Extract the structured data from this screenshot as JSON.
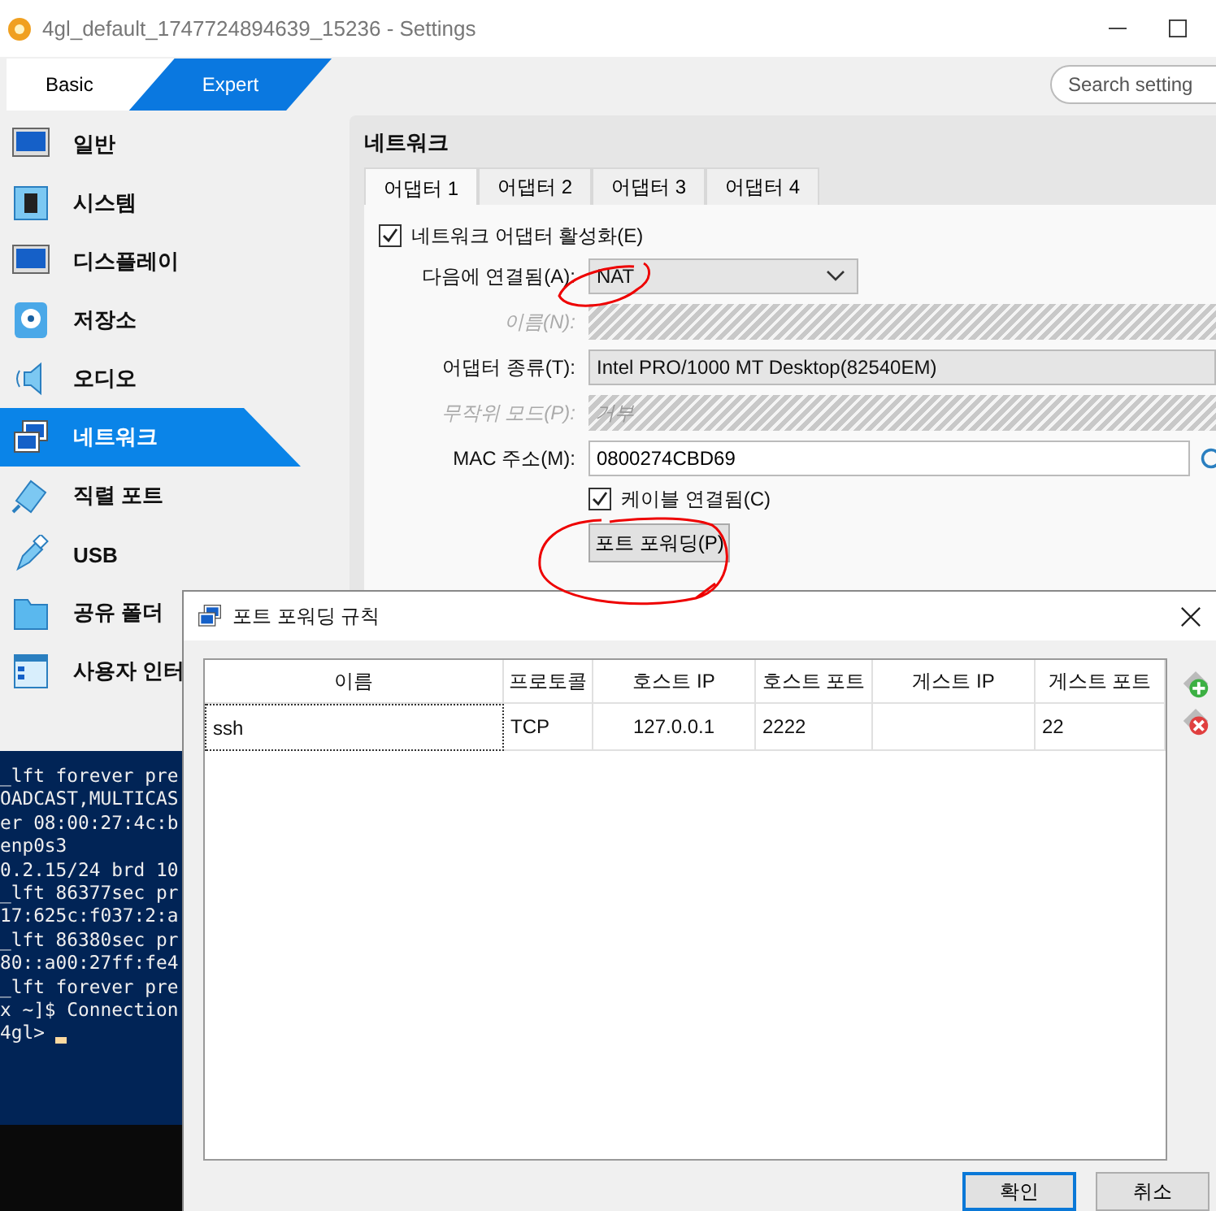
{
  "window": {
    "title": "4gl_default_1747724894639_15236 - Settings"
  },
  "mode_switch": [
    {
      "label": "Basic",
      "selected": false
    },
    {
      "label": "Expert",
      "selected": true
    }
  ],
  "search": {
    "placeholder": "Search setting"
  },
  "sidebar": {
    "items": [
      {
        "label": "일반",
        "kind": "monitor",
        "selected": false
      },
      {
        "label": "시스템",
        "kind": "chip",
        "selected": false
      },
      {
        "label": "디스플레이",
        "kind": "display",
        "selected": false
      },
      {
        "label": "저장소",
        "kind": "disk",
        "selected": false
      },
      {
        "label": "오디오",
        "kind": "speaker",
        "selected": false
      },
      {
        "label": "네트워크",
        "kind": "network",
        "selected": true
      },
      {
        "label": "직렬 포트",
        "kind": "serial",
        "selected": false
      },
      {
        "label": "USB",
        "kind": "usb",
        "selected": false
      },
      {
        "label": "공유 폴더",
        "kind": "folder",
        "selected": false
      },
      {
        "label": "사용자 인터",
        "kind": "ui",
        "selected": false
      }
    ]
  },
  "network": {
    "title": "네트워크",
    "tabs": [
      {
        "label": "어댑터 1",
        "selected": true
      },
      {
        "label": "어댑터 2",
        "selected": false
      },
      {
        "label": "어댑터 3",
        "selected": false
      },
      {
        "label": "어댑터 4",
        "selected": false
      }
    ],
    "enable_adapter": {
      "label": "네트워크 어댑터 활성화(E)",
      "checked": true
    },
    "fields": [
      {
        "label": "다음에 연결됨(A):",
        "kind": "dropdown",
        "value": "NAT",
        "disabled": false
      },
      {
        "label": "이름(N):",
        "kind": "wide",
        "disabled": true
      },
      {
        "label": "어댑터 종류(T):",
        "kind": "wide",
        "value": "Intel PRO/1000 MT Desktop(82540EM)",
        "disabled": false
      },
      {
        "label": "무작위 모드(P):",
        "kind": "wide",
        "value": "거부",
        "disabled": true
      },
      {
        "label": "MAC 주소(M):",
        "kind": "text",
        "value": "0800274CBD69",
        "disabled": false
      }
    ],
    "cable_connected": {
      "label": "케이블 연결됨(C)",
      "checked": true
    },
    "port_forwarding_button": "포트 포워딩(P)"
  },
  "terminal": {
    "lines": [
      "_lft forever pre",
      "OADCAST,MULTICAS",
      "er 08:00:27:4c:b",
      "enp0s3",
      "0.2.15/24 brd 10",
      "_lft 86377sec pr",
      "17:625c:f037:2:a",
      "_lft 86380sec pr",
      "80::a00:27ff:fe4",
      "_lft forever pre",
      "x ~]$ Connection",
      "4gl> "
    ]
  },
  "dialog": {
    "title": "포트 포워딩 규칙",
    "columns": [
      "이름",
      "프로토콜",
      "호스트 IP",
      "호스트 포트",
      "게스트 IP",
      "게스트 포트"
    ],
    "rows": [
      {
        "cells": [
          "ssh",
          "TCP",
          "127.0.0.1",
          "2222",
          "",
          "22"
        ],
        "selected": false
      }
    ],
    "buttons": [
      {
        "label": "확인",
        "selected": true
      },
      {
        "label": "취소",
        "selected": false
      }
    ]
  }
}
